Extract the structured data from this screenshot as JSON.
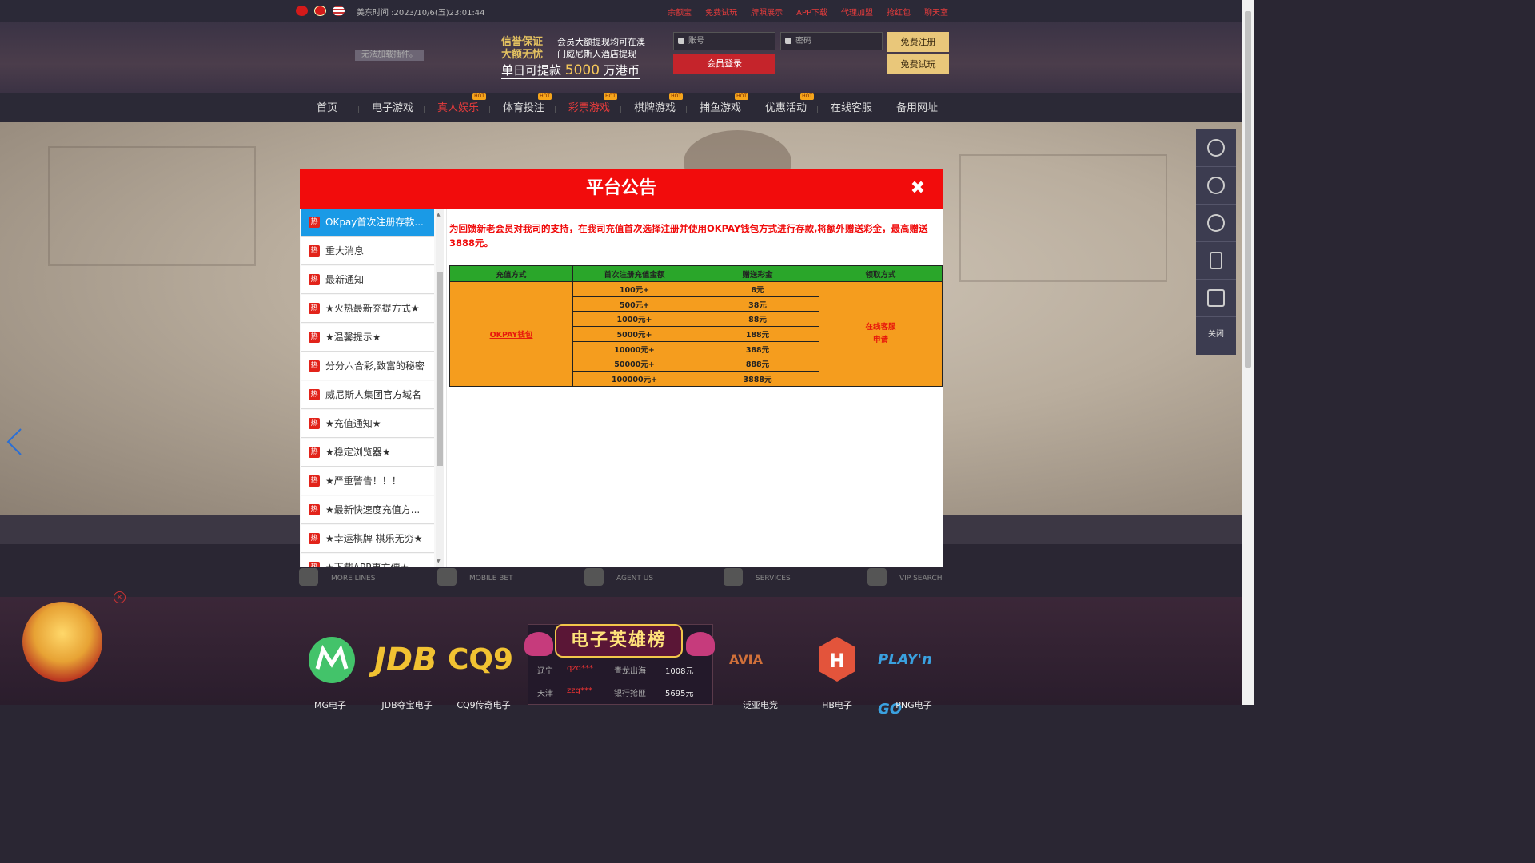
{
  "topbar": {
    "time": "美东时间 :2023/10/6(五)23:01:44",
    "links": [
      "余额宝",
      "免费试玩",
      "牌照展示",
      "APP下载",
      "代理加盟",
      "抢红包",
      "聊天室"
    ]
  },
  "header": {
    "plugin_text": "无法加载插件。",
    "promo_calligraphy": "信誉保证 大额无忧",
    "promo_line1": "会员大额提现均可在澳门威尼斯人酒店提现",
    "promo_big_prefix": "单日可提款",
    "promo_big_amount": "5000",
    "promo_big_suffix": "万港币",
    "account_placeholder": "账号",
    "password_placeholder": "密码",
    "login_label": "会员登录",
    "register_label": "免费注册",
    "trial_label": "免费试玩"
  },
  "nav": {
    "items": [
      {
        "label": "首页",
        "hot": false,
        "red": false
      },
      {
        "label": "电子游戏",
        "hot": false,
        "red": false
      },
      {
        "label": "真人娱乐",
        "hot": true,
        "red": true
      },
      {
        "label": "体育投注",
        "hot": true,
        "red": false
      },
      {
        "label": "彩票游戏",
        "hot": true,
        "red": true
      },
      {
        "label": "棋牌游戏",
        "hot": true,
        "red": false
      },
      {
        "label": "捕鱼游戏",
        "hot": true,
        "red": false
      },
      {
        "label": "优惠活动",
        "hot": true,
        "red": false
      },
      {
        "label": "在线客服",
        "hot": false,
        "red": false
      },
      {
        "label": "备用网址",
        "hot": false,
        "red": false
      }
    ],
    "hot_badge": "HOT"
  },
  "services": [
    {
      "label": "MORE LINES"
    },
    {
      "label": "MOBILE BET"
    },
    {
      "label": "AGENT US"
    },
    {
      "label": "SERVICES"
    },
    {
      "label": "VIP SEARCH"
    }
  ],
  "side_widget": {
    "close_label": "关闭"
  },
  "bottom": {
    "providers": [
      {
        "name": "MG电子",
        "color": "#45c46a"
      },
      {
        "name": "JDB夺宝电子",
        "color": "#f1c232"
      },
      {
        "name": "CQ9传奇电子",
        "color": "#f1c232"
      },
      {
        "name": "泛亚电竞",
        "color": "#d0703a"
      },
      {
        "name": "HB电子",
        "color": "#e3543b"
      },
      {
        "name": "PNG电子",
        "color": "#3aa1e0"
      }
    ],
    "leaderboard_title": "电子英雄榜",
    "leaderboard_rows": [
      {
        "region": "辽宁",
        "user": "qzd***",
        "game": "青龙出海",
        "amount": "1008元"
      },
      {
        "region": "天津",
        "user": "zzg***",
        "game": "银行抢匪",
        "amount": "5695元"
      }
    ]
  },
  "modal": {
    "title": "平台公告",
    "close_symbol": "✖",
    "hot_icon": "热",
    "list": [
      "OKpay首次注册存款...",
      "重大消息",
      "最新通知",
      "★火热最新充提方式★",
      "★温馨提示★",
      "分分六合彩,致富的秘密",
      "威尼斯人集团官方域名",
      "★充值通知★",
      "★稳定浏览器★",
      "★严重警告！！！",
      "★最新快速度充值方...",
      "★幸运棋牌 棋乐无穷★",
      "★下载APP更方便★"
    ],
    "intro": "为回馈新老会员对我司的支持，在我司充值首次选择注册并使用OKPAY钱包方式进行存款,将额外赠送彩金，最高赠送3888元。",
    "table": {
      "headers": [
        "充值方式",
        "首次注册充值金额",
        "赠送彩金",
        "领取方式"
      ],
      "method": "OKPAY钱包",
      "claim_line1": "在线客服",
      "claim_line2": "申请",
      "rows": [
        {
          "amount": "100元+",
          "bonus": "8元"
        },
        {
          "amount": "500元+",
          "bonus": "38元"
        },
        {
          "amount": "1000元+",
          "bonus": "88元"
        },
        {
          "amount": "5000元+",
          "bonus": "188元"
        },
        {
          "amount": "10000元+",
          "bonus": "388元"
        },
        {
          "amount": "50000元+",
          "bonus": "888元"
        },
        {
          "amount": "100000元+",
          "bonus": "3888元"
        }
      ]
    }
  }
}
